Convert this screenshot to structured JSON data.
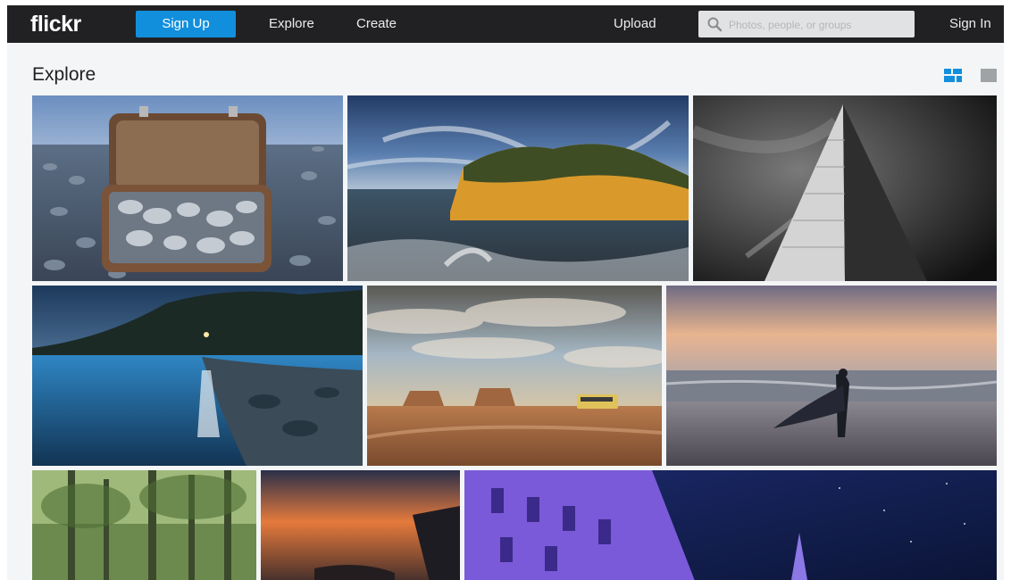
{
  "nav": {
    "logo": "flickr",
    "signup": "Sign Up",
    "explore": "Explore",
    "create": "Create",
    "upload": "Upload",
    "search_placeholder": "Photos, people, or groups",
    "signin": "Sign In"
  },
  "page": {
    "title": "Explore"
  },
  "colors": {
    "nav_bg": "#212124",
    "accent": "#128fdc",
    "page_bg": "#f3f5f6"
  },
  "view_toggle": {
    "active": "justified-view-icon",
    "inactive": "single-view-icon"
  },
  "photos": [
    "suitcase-of-pebbles-on-beach",
    "golden-rock-cliff-over-sea",
    "black-and-white-skyscraper",
    "blue-lake-bay-at-night",
    "desert-road-with-bus-under-clouds",
    "woman-with-flowing-scarf-on-beach",
    "green-forest-trees",
    "orange-sunset-over-sea-rocks",
    "purple-lit-cathedral-night"
  ]
}
